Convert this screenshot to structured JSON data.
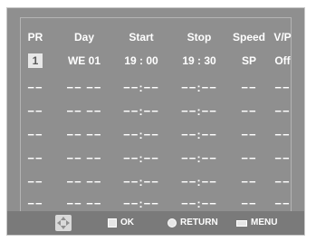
{
  "header": {
    "pr": "PR",
    "day": "Day",
    "start": "Start",
    "stop": "Stop",
    "speed": "Speed",
    "vp": "V/P"
  },
  "rows": [
    {
      "pr": "1",
      "day": "WE  01",
      "start": "19 : 00",
      "stop": "19 : 30",
      "speed": "SP",
      "vp": "Off"
    },
    {
      "pr": "−−",
      "day": "−− −−",
      "start": "−−:−−",
      "stop": "−−:−−",
      "speed": "−−",
      "vp": "−−"
    },
    {
      "pr": "−−",
      "day": "−− −−",
      "start": "−−:−−",
      "stop": "−−:−−",
      "speed": "−−",
      "vp": "−−"
    },
    {
      "pr": "−−",
      "day": "−− −−",
      "start": "−−:−−",
      "stop": "−−:−−",
      "speed": "−−",
      "vp": "−−"
    },
    {
      "pr": "−−",
      "day": "−− −−",
      "start": "−−:−−",
      "stop": "−−:−−",
      "speed": "−−",
      "vp": "−−"
    },
    {
      "pr": "−−",
      "day": "−− −−",
      "start": "−−:−−",
      "stop": "−−:−−",
      "speed": "−−",
      "vp": "−−"
    },
    {
      "pr": "−−",
      "day": "−− −−",
      "start": "−−:−−",
      "stop": "−−:−−",
      "speed": "−−",
      "vp": "−−"
    }
  ],
  "footer": {
    "nav_icon": "four-way-arrows-icon",
    "ok_icon": "ok-enter-icon",
    "ok_label": "OK",
    "return_icon": "return-icon",
    "return_label": "RETURN",
    "menu_icon": "menu-icon",
    "menu_label": "MENU"
  },
  "colors": {
    "background": "#8f8f8f",
    "footer": "#7a7a7a",
    "text": "#ffffff"
  }
}
